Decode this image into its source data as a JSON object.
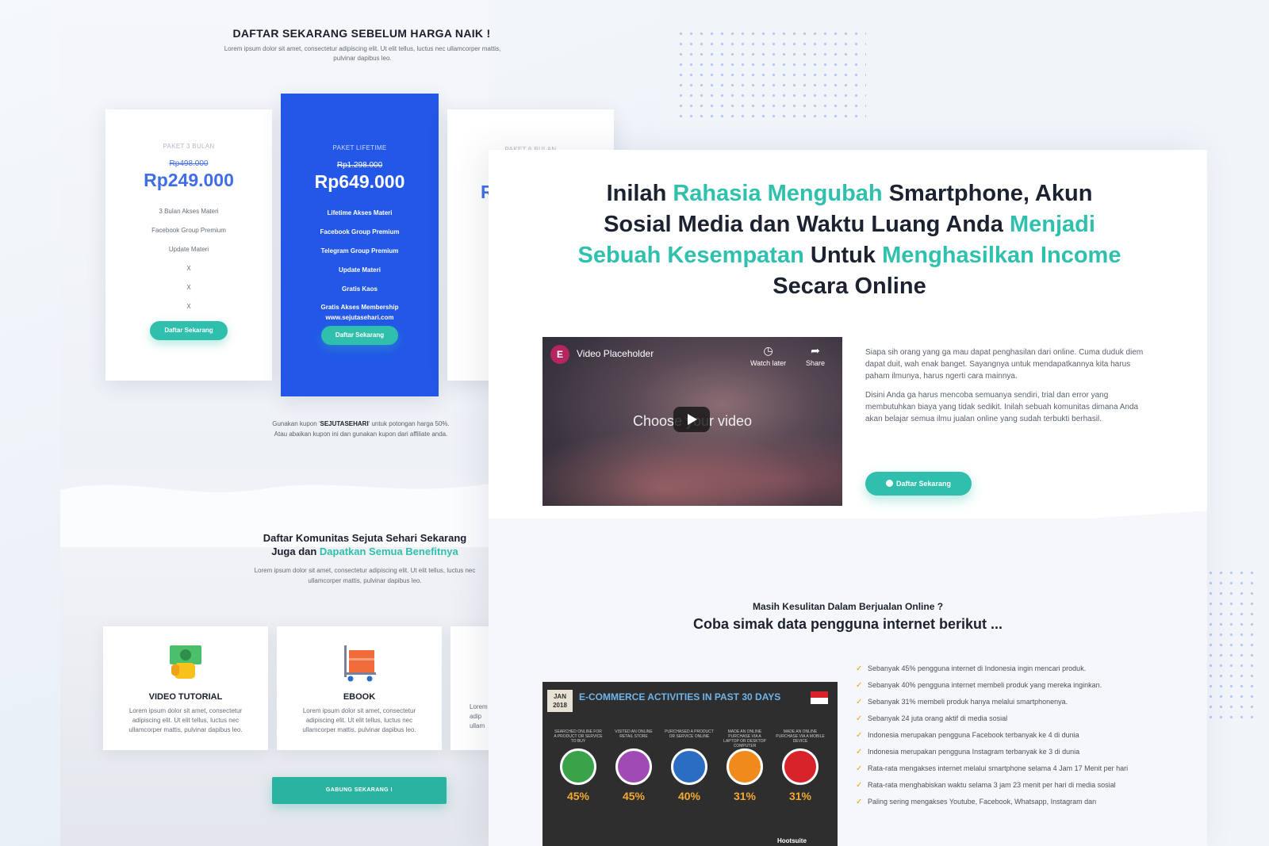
{
  "pricing": {
    "title": "DAFTAR SEKARANG SEBELUM HARGA NAIK !",
    "subtitle": "Lorem ipsum dolor sit amet, consectetur adipiscing elit. Ut elit tellus, luctus nec ullamcorper mattis, pulvinar dapibus leo.",
    "cards": [
      {
        "package": "PAKET 3 BULAN",
        "old_price": "Rp498.000",
        "price": "Rp249.000",
        "features": [
          "3 Bulan Akses Materi",
          "Facebook Group Premium",
          "Update Materi",
          "X",
          "X",
          "X"
        ],
        "button": "Daftar Sekarang"
      },
      {
        "package": "PAKET LIFETIME",
        "old_price": "Rp1.298.000",
        "price": "Rp649.000",
        "features": [
          "Lifetime Akses Materi",
          "Facebook Group Premium",
          "Telegram Group Premium",
          "Update Materi",
          "Gratis Kaos",
          "Gratis Akses Membership www.sejutasehari.com"
        ],
        "button": "Daftar Sekarang"
      },
      {
        "package": "PAKET 6 BULAN",
        "price_partial": "R"
      }
    ],
    "coupon_prefix": "Gunakan kupon '",
    "coupon_code": "SEJUTASEHARI",
    "coupon_suffix": "' untuk potongan harga 50%.",
    "coupon_line2": "Atau abaikan kupon ini dan gunakan kupon dari affiliate anda."
  },
  "community": {
    "title_line1": "Daftar Komunitas Sejuta Sehari Sekarang",
    "title_prefix": "Juga dan ",
    "title_highlight": "Dapatkan Semua Benefitnya",
    "subtitle": "Lorem ipsum dolor sit amet, consectetur adipiscing elit. Ut elit tellus, luctus nec ullamcorper mattis, pulvinar dapibus leo.",
    "features": [
      {
        "title": "VIDEO TUTORIAL",
        "desc": "Lorem ipsum dolor sit amet, consectetur adipiscing elit. Ut elit tellus, luctus nec ullamcorper mattis, pulvinar dapibus leo."
      },
      {
        "title": "EBOOK",
        "desc": "Lorem ipsum dolor sit amet, consectetur adipiscing elit. Ut elit tellus, luctus nec ullamcorper mattis, pulvinar dapibus leo."
      },
      {
        "title": "",
        "desc": "Lorem adip ullam"
      }
    ],
    "join_button": "GABUNG SEKARANG !"
  },
  "hero": {
    "headline": [
      {
        "t": "Inilah ",
        "hl": false
      },
      {
        "t": "Rahasia Mengubah",
        "hl": true
      },
      {
        "t": " Smartphone, Akun Sosial Media dan Waktu Luang Anda ",
        "hl": false
      },
      {
        "t": "Menjadi Sebuah Kesempatan",
        "hl": true
      },
      {
        "t": " Untuk ",
        "hl": false
      },
      {
        "t": "Menghasilkan Income",
        "hl": true
      },
      {
        "t": " Secara Online",
        "hl": false
      }
    ],
    "video": {
      "title": "Video Placeholder",
      "watch_later": "Watch later",
      "share": "Share",
      "overlay": "Choose your video"
    },
    "paragraph1": "Siapa sih orang yang ga mau dapat penghasilan dari online. Cuma duduk diem dapat duit, wah enak banget. Sayangnya untuk mendapatkannya kita harus paham ilmunya, harus ngerti cara mainnya.",
    "paragraph2": "Disini Anda ga harus mencoba semuanya sendiri, trial dan error yang membutuhkan biaya yang tidak sedikit. Inilah sebuah komunitas dimana Anda akan belajar semua ilmu jualan online yang sudah terbukti berhasil.",
    "button": "Daftar Sekarang"
  },
  "data_section": {
    "question": "Masih Kesulitan Dalam Berjualan Online ?",
    "title": "Coba simak data  pengguna internet berikut ...",
    "infographic": {
      "badge_month": "JAN",
      "badge_year": "2018",
      "title": "E-COMMERCE ACTIVITIES IN PAST 30 DAYS",
      "stats": [
        {
          "label": "SEARCHED ONLINE FOR A PRODUCT OR SERVICE TO BUY",
          "value": "45%",
          "color": "#3aa34a"
        },
        {
          "label": "VISITED AN ONLINE RETAIL STORE",
          "value": "45%",
          "color": "#a04bb5"
        },
        {
          "label": "PURCHASED A PRODUCT OR SERVICE ONLINE",
          "value": "40%",
          "color": "#2a6dc2"
        },
        {
          "label": "MADE AN ONLINE PURCHASE VIA A LAPTOP OR DESKTOP COMPUTER",
          "value": "31%",
          "color": "#f08a1c"
        },
        {
          "label": "MADE AN ONLINE PURCHASE VIA A MOBILE DEVICE",
          "value": "31%",
          "color": "#d8232a"
        }
      ],
      "footer": "Hootsuite"
    },
    "facts": [
      "Sebanyak 45% pengguna internet di Indonesia ingin mencari produk.",
      "Sebanyak 40% pengguna internet membeli produk yang mereka inginkan.",
      "Sebanyak 31% membeli produk hanya melalui smartphonenya.",
      "Sebanyak 24 juta orang aktif di media sosial",
      "Indonesia merupakan pengguna Facebook terbanyak ke 4 di dunia",
      "Indonesia merupakan pengguna Instagram terbanyak ke 3 di dunia",
      "Rata-rata mengakses internet melalui smartphone selama 4 Jam 17 Menit per hari",
      "Rata-rata menghabiskan waktu selama 3 jam 23 menit per hari di media sosial",
      "Paling sering mengakses Youtube, Facebook, Whatsapp, Instagram dan"
    ]
  },
  "colors": {
    "accent": "#2fbfac",
    "primary_blue": "#2357e8",
    "check": "#f0a11a"
  }
}
